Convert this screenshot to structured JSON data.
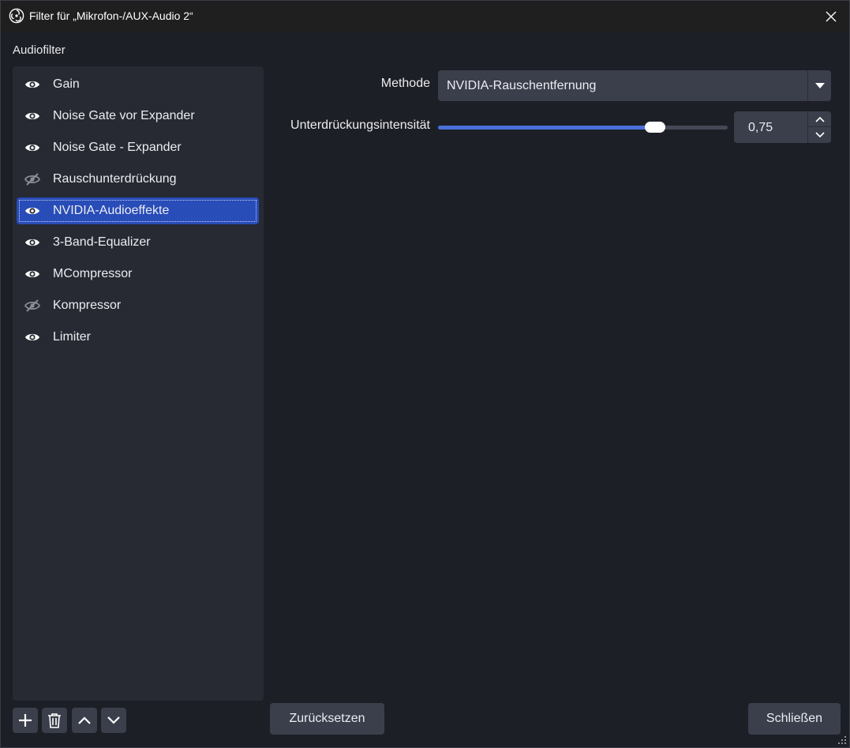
{
  "window": {
    "title": "Filter für „Mikrofon-/AUX-Audio 2“",
    "close_glyph": "✕"
  },
  "sidebar": {
    "heading": "Audiofilter",
    "items": [
      {
        "label": "Gain",
        "visible": true
      },
      {
        "label": "Noise Gate vor Expander",
        "visible": true
      },
      {
        "label": "Noise Gate - Expander",
        "visible": true
      },
      {
        "label": "Rauschunterdrückung",
        "visible": false
      },
      {
        "label": "NVIDIA-Audioeffekte",
        "visible": true,
        "selected": true
      },
      {
        "label": "3-Band-Equalizer",
        "visible": true
      },
      {
        "label": "MCompressor",
        "visible": true
      },
      {
        "label": "Kompressor",
        "visible": false
      },
      {
        "label": "Limiter",
        "visible": true
      }
    ],
    "toolbar": {
      "add_icon": "plus-icon",
      "remove_icon": "trash-icon",
      "move_up_icon": "chevron-up-icon",
      "move_down_icon": "chevron-down-icon"
    }
  },
  "properties": {
    "method_label": "Methode",
    "method_value": "NVIDIA-Rauschentfernung",
    "intensity_label": "Unterdrückungsintensität",
    "intensity_value": "0,75",
    "intensity_fraction": 0.75
  },
  "buttons": {
    "reset": "Zurücksetzen",
    "close": "Schließen"
  },
  "colors": {
    "accent": "#284cb8",
    "slider_fill": "#4a70d9",
    "panel": "#272a33",
    "background": "#1d1f26"
  }
}
